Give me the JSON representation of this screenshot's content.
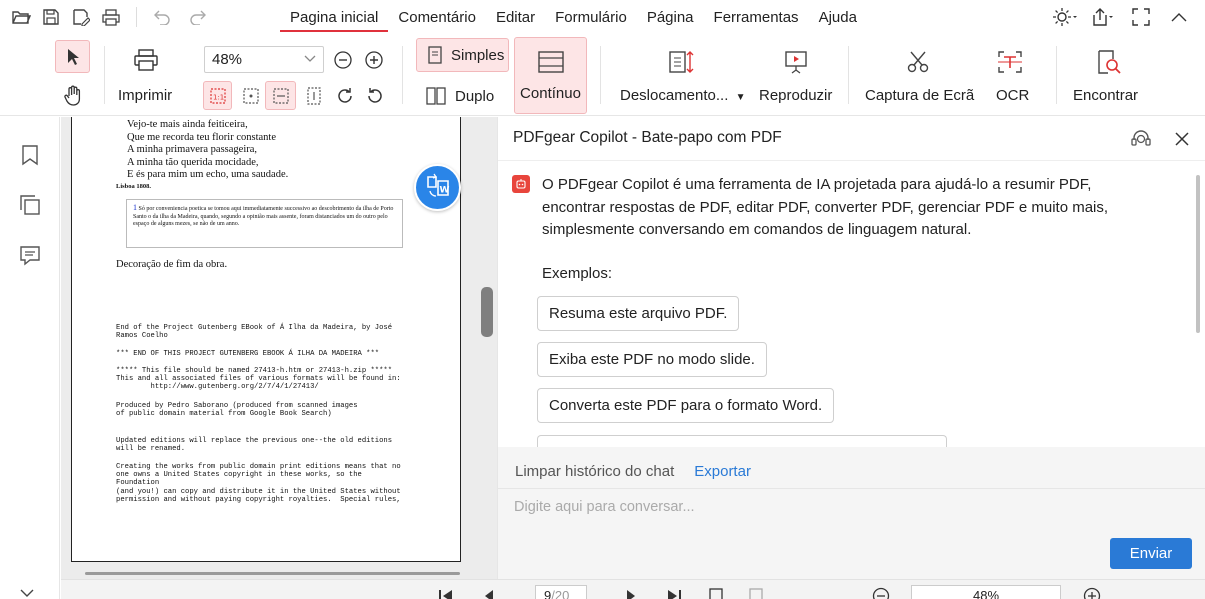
{
  "menu": {
    "tabs": [
      "Pagina inicial",
      "Comentário",
      "Editar",
      "Formulário",
      "Página",
      "Ferramentas",
      "Ajuda"
    ],
    "active_tab": "Pagina inicial"
  },
  "ribbon": {
    "print_label": "Imprimir",
    "zoom_value": "48%",
    "single_label": "Simples",
    "double_label": "Duplo",
    "continuous_label": "Contínuo",
    "scroll_label": "Deslocamento...",
    "play_label": "Reproduzir",
    "capture_label": "Captura de Ecrã",
    "ocr_label": "OCR",
    "find_label": "Encontrar"
  },
  "document": {
    "poem_lines": [
      "Vejo-te mais ainda feiticeira,",
      "Que me recorda teu florir constante",
      "A minha primavera passageira,",
      "A minha tão querida mocidade,",
      "E és para mim um echo, uma saudade."
    ],
    "place_date": "Lisboa 1808.",
    "footnote_number": "1",
    "footnote_text": "Só por conveniencia poetica se tomou aqui immediatamente successivo ao descobrimento da ilha de Porto Santo o da ilha da Madeira, quando, segundo a opinião mais assente, foram distanciados um do outro pelo espaço de alguns mezes, se não de um anno.",
    "decoration": "Decoração de fim da obra.",
    "mono_blocks": [
      "End of the Project Gutenberg EBook of Á Ilha da Madeira, by José\nRamos Coelho",
      "*** END OF THIS PROJECT GUTENBERG EBOOK Á ILHA DA MADEIRA ***",
      "***** This file should be named 27413-h.htm or 27413-h.zip *****\nThis and all associated files of various formats will be found in:\n        http://www.gutenberg.org/2/7/4/1/27413/",
      "Produced by Pedro Saborano (produced from scanned images\nof public domain material from Google Book Search)",
      "Updated editions will replace the previous one--the old editions\nwill be renamed.",
      "Creating the works from public domain print editions means that no\none owns a United States copyright in these works, so the\nFoundation\n(and you!) can copy and distribute it in the United States without\npermission and without paying copyright royalties.  Special rules,"
    ]
  },
  "status": {
    "page_current": "9",
    "page_total": "/20",
    "zoom": "48%"
  },
  "copilot": {
    "title": "PDFgear Copilot - Bate-papo com PDF",
    "intro": "O PDFgear Copilot é uma ferramenta de IA projetada para ajudá-lo a resumir PDF, encontrar respostas de PDF, editar PDF, converter PDF, gerenciar PDF e muito mais, simplesmente conversando em comandos de linguagem natural.",
    "examples_label": "Exemplos:",
    "examples": [
      "Resuma este arquivo PDF.",
      "Exiba este PDF no modo slide.",
      "Converta este PDF para o formato Word."
    ],
    "clear_history": "Limpar histórico do chat",
    "export": "Exportar",
    "input_placeholder": "Digite aqui para conversar...",
    "send": "Enviar"
  },
  "colors": {
    "accent_red": "#e0313c",
    "accent_blue": "#2a7ad6",
    "selected_bg": "#fde5e6"
  }
}
